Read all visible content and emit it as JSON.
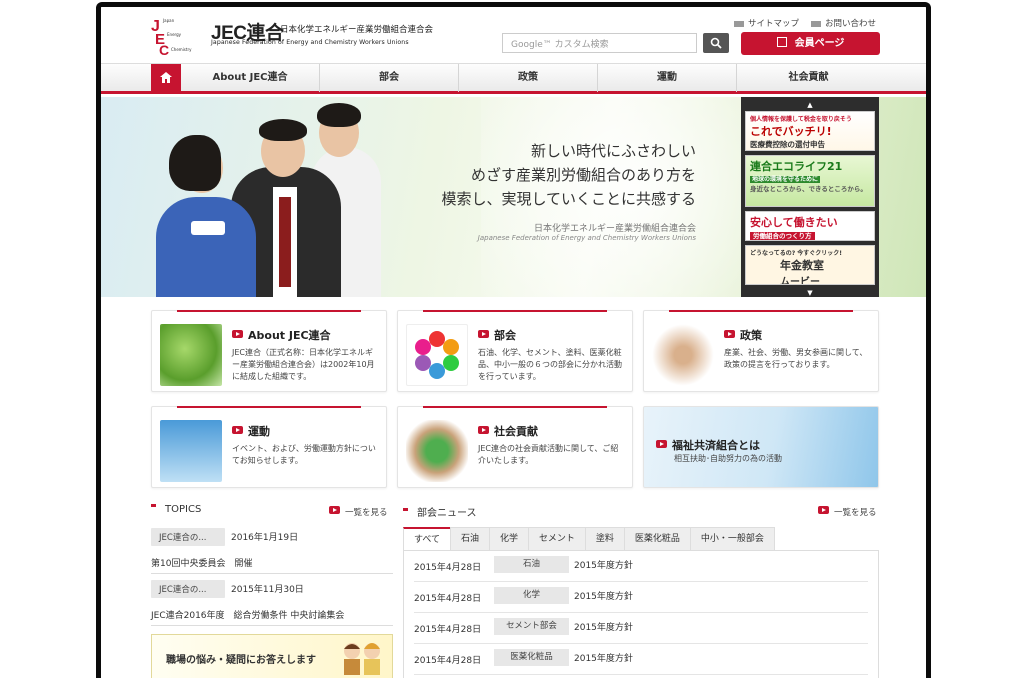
{
  "header": {
    "logo_mark": "Japan Energy Chemistry",
    "logo_title": "JEC連合",
    "logo_subtitle_jp": "日本化学エネルギー産業労働組合連合会",
    "logo_subtitle_en": "Japanese Federation of Energy and Chemistry Workers Unions",
    "links": [
      "サイトマップ",
      "お問い合わせ"
    ],
    "search_placeholder": "Google™ カスタム検索",
    "member_button": "会員ページ"
  },
  "nav": {
    "items": [
      "About JEC連合",
      "部会",
      "政策",
      "運動",
      "社会貢献"
    ]
  },
  "hero": {
    "lines": [
      "新しい時代にふさわしい",
      "めざす産業別労働組合のあり方を",
      "模索し、実現していくことに共感する"
    ],
    "org_jp": "日本化学エネルギー産業労働組合連合会",
    "org_en": "Japanese Federation of Energy and Chemistry Workers Unions",
    "banners": [
      {
        "small": "個人情報を保護して税金を取り戻そう",
        "big": "これでバッチリ!",
        "sub": "医療費控除の還付申告"
      },
      {
        "small": "連合エコライフ21",
        "big": "地球の環境を守るために",
        "sub": "身近なところから、できるところから。"
      },
      {
        "small": "安心して働きたい",
        "big": "労働組合のつくり方",
        "sub": ""
      },
      {
        "small": "どうなってるの? 今すぐクリック!",
        "big": "年金教室",
        "sub": "ムービー"
      }
    ]
  },
  "cards": [
    {
      "title": "About JEC連合",
      "desc": "JEC連合（正式名称：日本化学エネルギー産業労働組合連合会）は2002年10月に結成した組織です。"
    },
    {
      "title": "部会",
      "desc": "石油、化学、セメント、塗料、医薬化粧品、中小一般の６つの部会に分かれ活動を行っています。"
    },
    {
      "title": "政策",
      "desc": "産業、社会、労働、男女参画に関して、政策の提言を行っております。"
    },
    {
      "title": "運動",
      "desc": "イベント、および、労働運動方針についてお知らせします。"
    },
    {
      "title": "社会貢献",
      "desc": "JEC連合の社会貢献活動に関して、ご紹介いたします。"
    },
    {
      "title": "福祉共済組合とは",
      "desc": "相互扶助･自助努力の為の活動"
    }
  ],
  "topics": {
    "heading": "TOPICS",
    "more": "一覧を見る",
    "items": [
      {
        "tag": "JEC連合の...",
        "date": "2016年1月19日",
        "title": "第10回中央委員会　開催"
      },
      {
        "tag": "JEC連合の...",
        "date": "2015年11月30日",
        "title": "JEC連合2016年度　総合労働条件 中央討論集会"
      }
    ],
    "banner": "職場の悩み・疑問にお答えします"
  },
  "news": {
    "heading": "部会ニュース",
    "more": "一覧を見る",
    "tabs": [
      "すべて",
      "石油",
      "化学",
      "セメント",
      "塗料",
      "医薬化粧品",
      "中小・一般部会"
    ],
    "rows": [
      {
        "date": "2015年4月28日",
        "cat": "石油",
        "title": "2015年度方針"
      },
      {
        "date": "2015年4月28日",
        "cat": "化学",
        "title": "2015年度方針"
      },
      {
        "date": "2015年4月28日",
        "cat": "セメント部会",
        "title": "2015年度方針"
      },
      {
        "date": "2015年4月28日",
        "cat": "医薬化粧品",
        "title": "2015年度方針"
      }
    ]
  },
  "colors": {
    "accent": "#c61430",
    "nav_bg": "#eeeeee"
  }
}
